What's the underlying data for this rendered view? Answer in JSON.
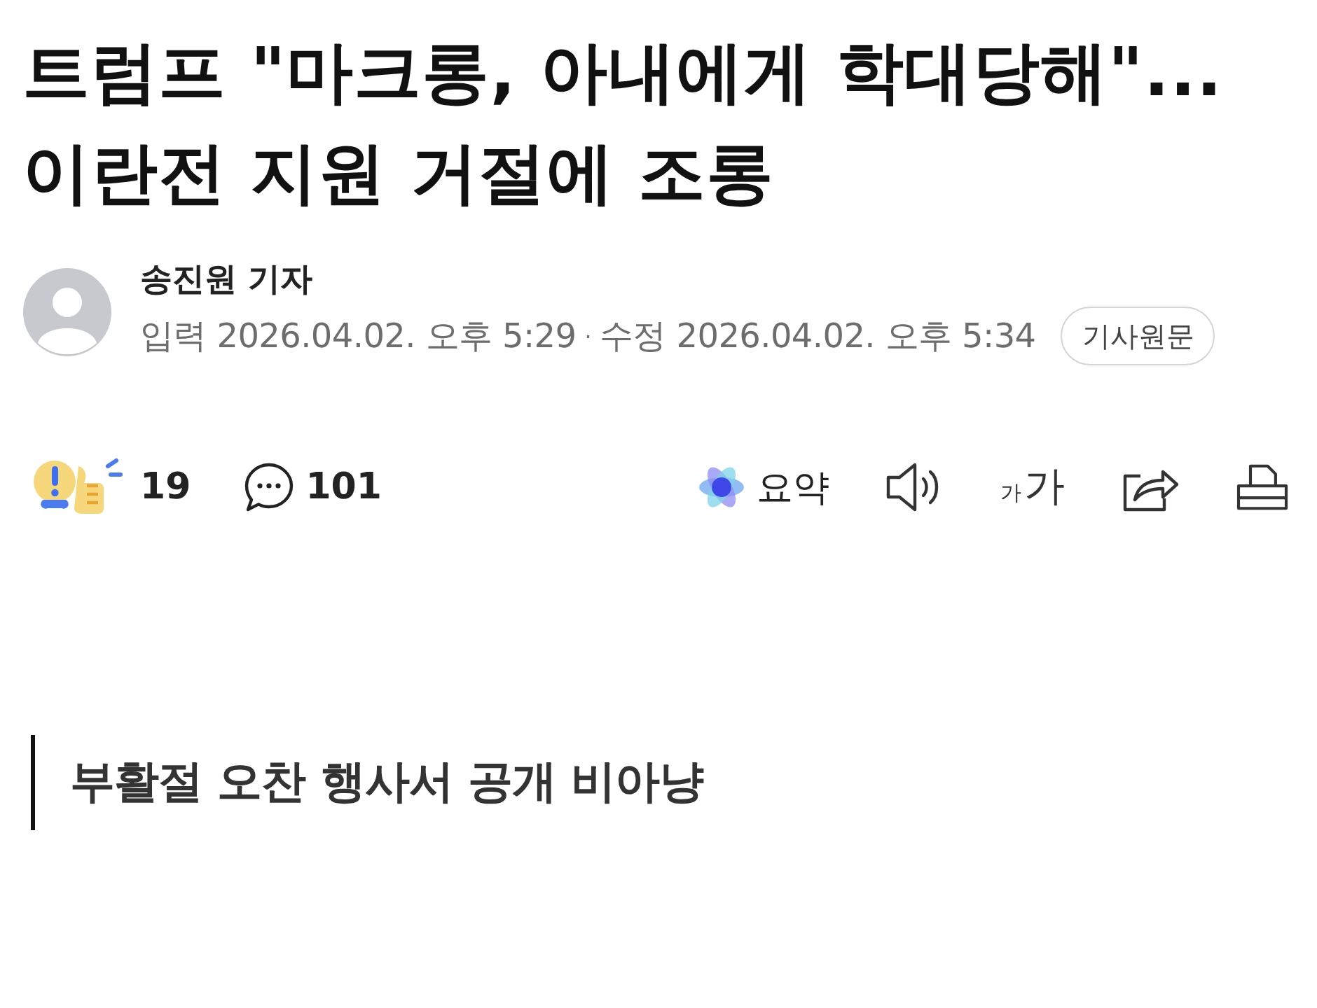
{
  "headline": "트럼프 \"마크롱, 아내에게 학대당해\"... 이란전 지원 거절에 조롱",
  "byline": {
    "reporter": "송진원 기자",
    "published_label": "입력",
    "published": "2026.04.02. 오후 5:29",
    "separator": "·",
    "modified_label": "수정",
    "modified": "2026.04.02. 오후 5:34",
    "original_button": "기사원문"
  },
  "actions": {
    "reactions": "19",
    "comments": "101",
    "summary": "요약",
    "font_size": {
      "small": "가",
      "large": "가"
    }
  },
  "subheading": "부활절 오찬 행사서 공개 비아냥"
}
